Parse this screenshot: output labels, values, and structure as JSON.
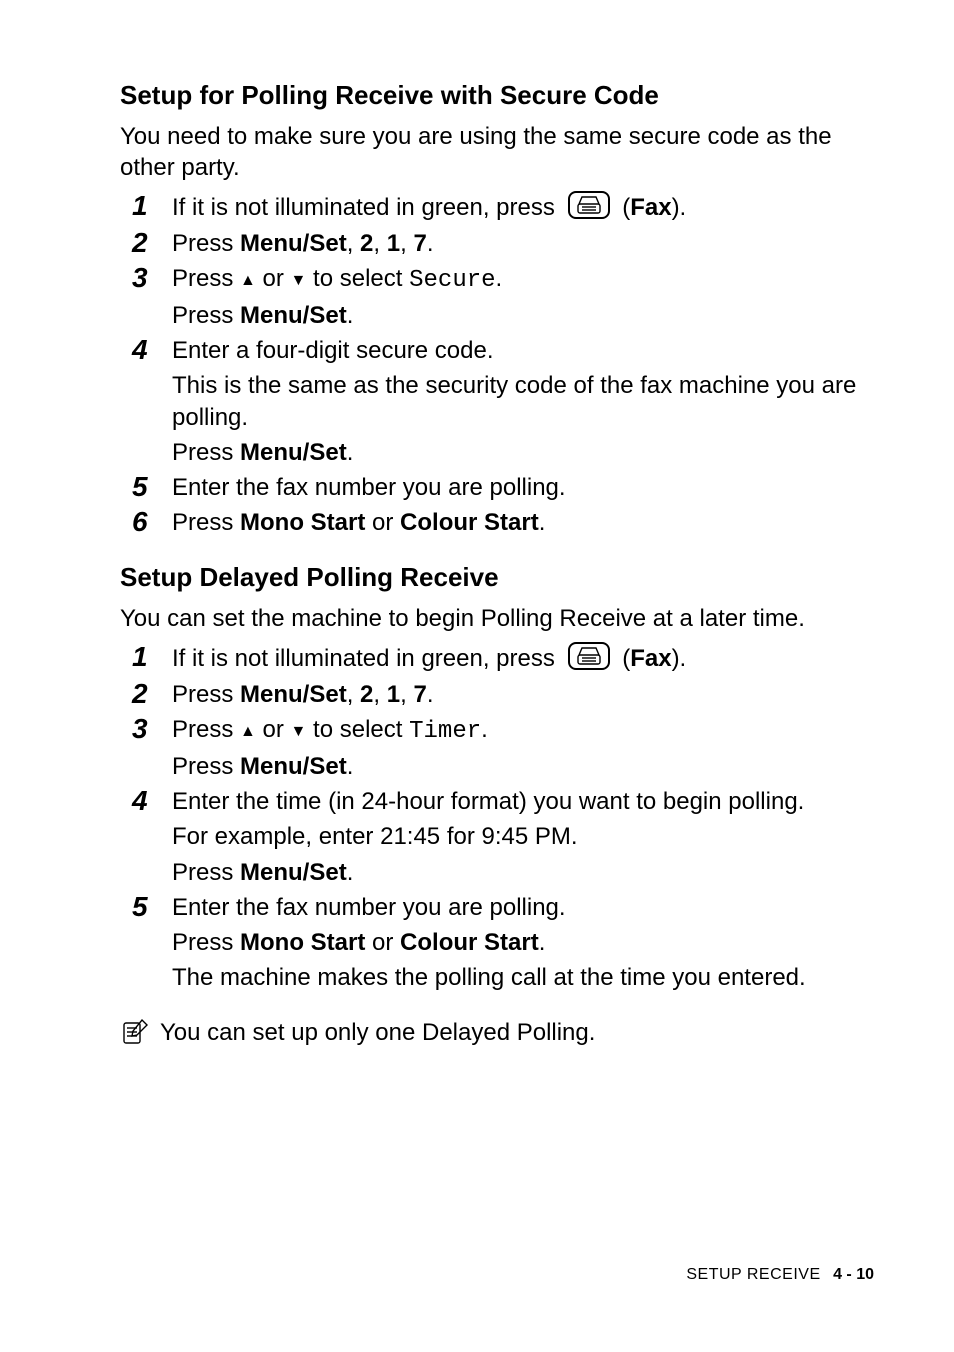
{
  "section1": {
    "heading": "Setup for Polling Receive with Secure Code",
    "intro": "You need to make sure you are using the same secure code as the other party.",
    "steps": [
      {
        "num": "1",
        "pre": "If it is not illuminated in green, press ",
        "post": " (",
        "boldAfterIcon": "Fax",
        "tail": ")."
      },
      {
        "num": "2",
        "parts": [
          "Press ",
          "Menu/Set",
          ", ",
          "2",
          ", ",
          "1",
          ", ",
          "7",
          "."
        ]
      },
      {
        "num": "3",
        "line1_prefix": "Press ",
        "line1_mid": " or ",
        "line1_suffix": " to select ",
        "line1_mono": "Secure",
        "line1_end": ".",
        "line2_pre": "Press ",
        "line2_bold": "Menu/Set",
        "line2_end": "."
      },
      {
        "num": "4",
        "line1": "Enter a four-digit secure code.",
        "line2": "This is the same as the security code of the fax machine you are polling.",
        "line3_pre": "Press ",
        "line3_bold": "Menu/Set",
        "line3_end": "."
      },
      {
        "num": "5",
        "line1": "Enter the fax number you are polling."
      },
      {
        "num": "6",
        "parts": [
          "Press ",
          "Mono Start",
          " or ",
          "Colour Start",
          "."
        ]
      }
    ]
  },
  "section2": {
    "heading": "Setup Delayed Polling Receive",
    "intro": "You can set the machine to begin Polling Receive at a later time.",
    "steps": [
      {
        "num": "1",
        "pre": "If it is not illuminated in green, press ",
        "post": " (",
        "boldAfterIcon": "Fax",
        "tail": ")."
      },
      {
        "num": "2",
        "parts": [
          "Press ",
          "Menu/Set",
          ", ",
          "2",
          ", ",
          "1",
          ", ",
          "7",
          "."
        ]
      },
      {
        "num": "3",
        "line1_prefix": "Press ",
        "line1_mid": " or ",
        "line1_suffix": " to select ",
        "line1_mono": "Timer",
        "line1_end": ".",
        "line2_pre": "Press ",
        "line2_bold": "Menu/Set",
        "line2_end": "."
      },
      {
        "num": "4",
        "line1": "Enter the time (in 24-hour format) you want to begin polling.",
        "line2": "For example, enter 21:45 for 9:45 PM.",
        "line3_pre": "Press ",
        "line3_bold": "Menu/Set",
        "line3_end": "."
      },
      {
        "num": "5",
        "line1": "Enter the fax number you are polling.",
        "line2_parts": [
          "Press ",
          "Mono Start",
          " or ",
          "Colour Start",
          "."
        ],
        "line3": "The machine makes the polling call at the time you entered."
      }
    ],
    "note": "You can set up only one Delayed Polling."
  },
  "footer": {
    "label": "SETUP RECEIVE",
    "page": "4 - 10"
  }
}
